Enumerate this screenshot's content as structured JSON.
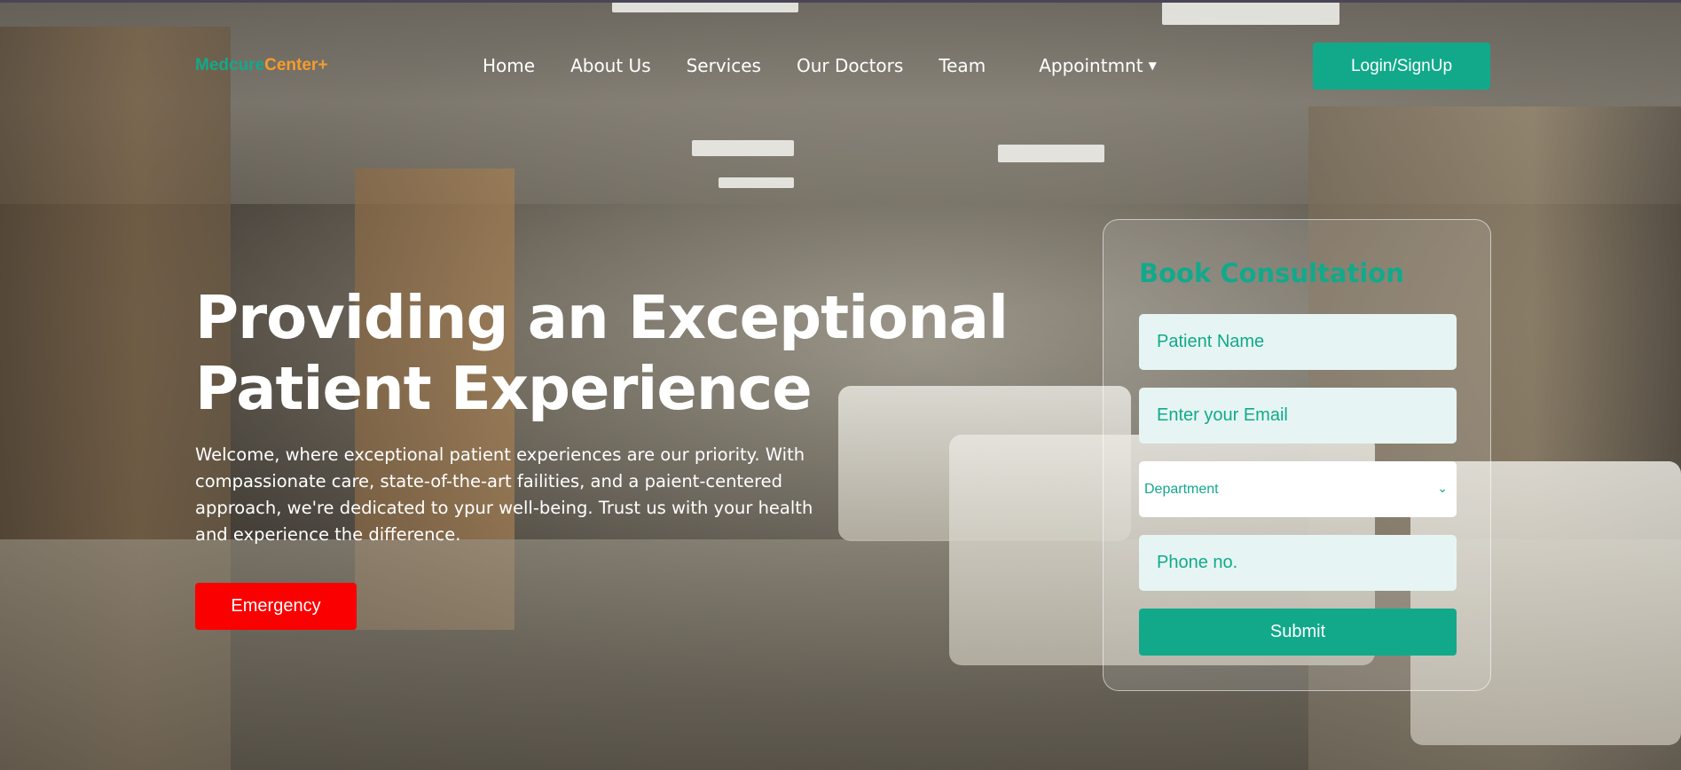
{
  "brand": {
    "part1": "Medcure",
    "part2": "Center+"
  },
  "nav": {
    "items": [
      {
        "label": "Home"
      },
      {
        "label": "About Us"
      },
      {
        "label": "Services"
      },
      {
        "label": "Our Doctors"
      },
      {
        "label": "Team"
      }
    ],
    "appointment_label": "Appointmnt",
    "login_label": "Login/SignUp"
  },
  "hero": {
    "title_line1": "Providing an Exceptional",
    "title_line2": "Patient Experience",
    "description": "Welcome, where exceptional patient experiences are our priority. With compassionate care, state-of-the-art failities, and a paient-centered approach, we're dedicated to ypur well-being. Trust us with your health and experience the difference.",
    "emergency_label": "Emergency"
  },
  "form": {
    "title": "Book Consultation",
    "name_placeholder": "Patient Name",
    "email_placeholder": "Enter your Email",
    "department_value": "Department",
    "phone_placeholder": "Phone no.",
    "submit_label": "Submit"
  },
  "colors": {
    "accent": "#12a98b",
    "brand_secondary": "#f59c2e",
    "emergency": "#fb0000",
    "field_bg": "#e6f5f3"
  },
  "icons": {
    "dropdown": "caret-down-icon",
    "select": "chevron-down-icon"
  }
}
